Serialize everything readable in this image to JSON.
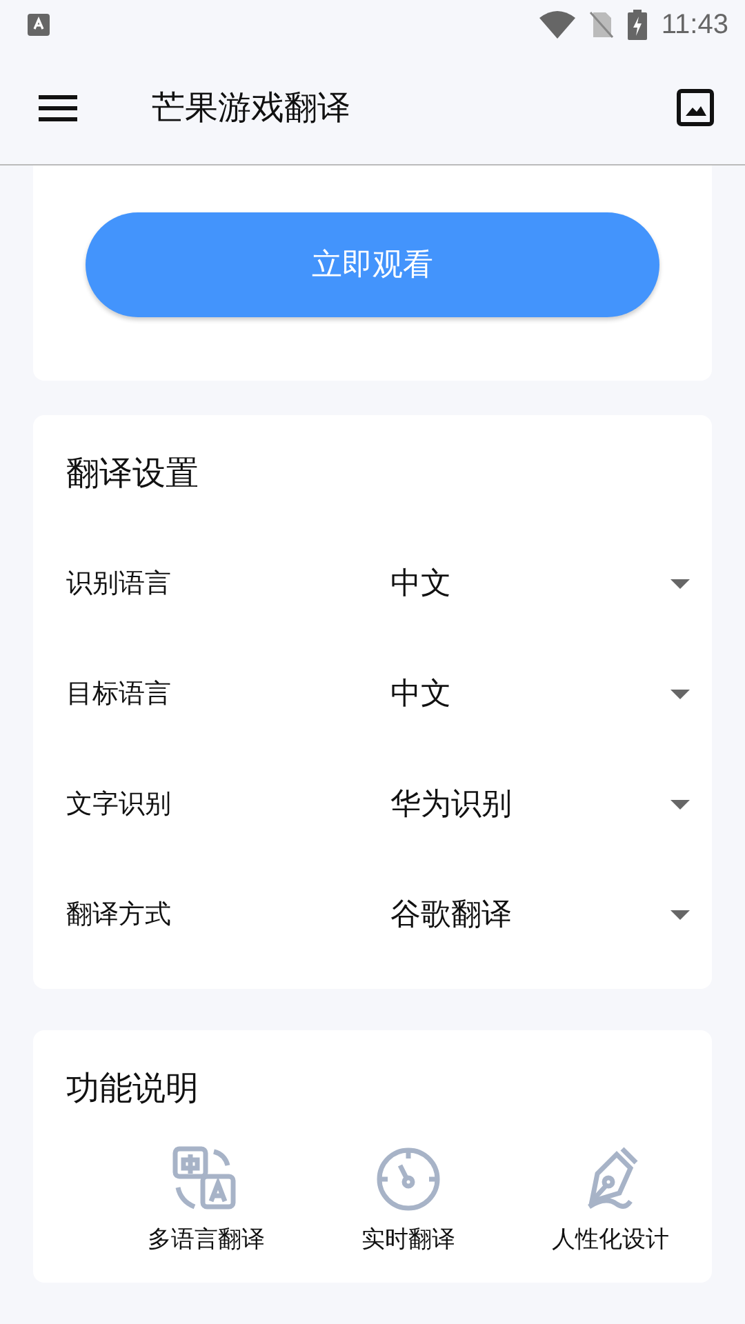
{
  "status_bar": {
    "time": "11:43"
  },
  "app_bar": {
    "title": "芒果游戏翻译"
  },
  "watch_button": {
    "label": "立即观看"
  },
  "settings": {
    "title": "翻译设置",
    "rows": [
      {
        "label": "识别语言",
        "value": "中文"
      },
      {
        "label": "目标语言",
        "value": "中文"
      },
      {
        "label": "文字识别",
        "value": "华为识别"
      },
      {
        "label": "翻译方式",
        "value": "谷歌翻译"
      }
    ]
  },
  "features": {
    "title": "功能说明",
    "items": [
      {
        "kind": "translate",
        "label": "多语言翻译"
      },
      {
        "kind": "speed",
        "label": "实时翻译"
      },
      {
        "kind": "pen",
        "label": "人性化设计"
      }
    ]
  }
}
